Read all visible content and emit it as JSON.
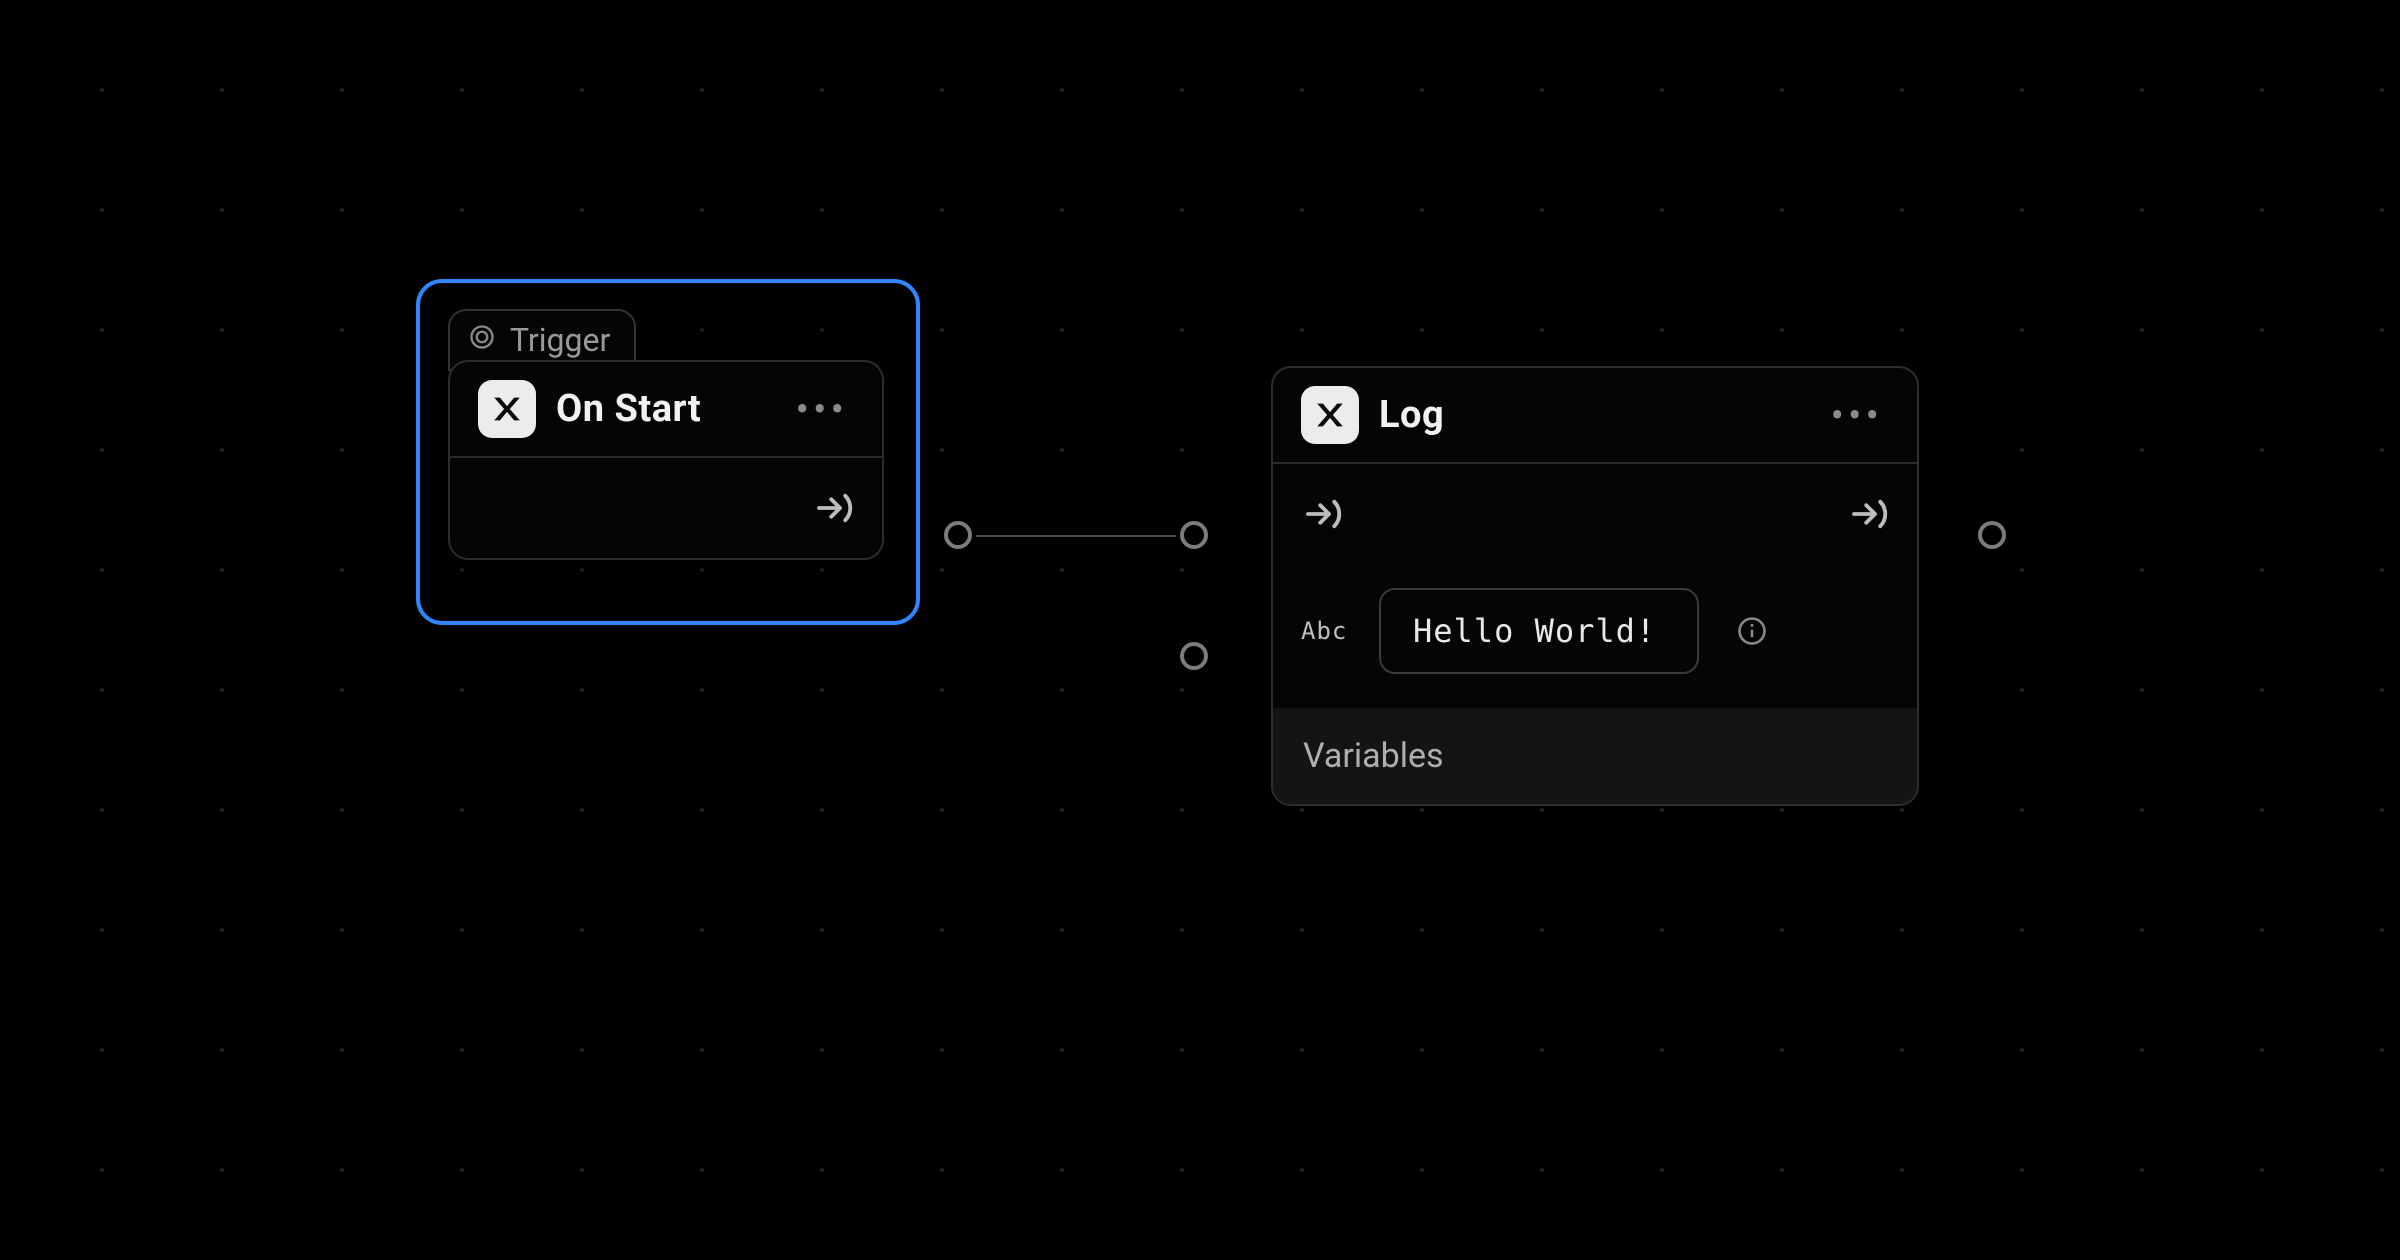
{
  "canvas": {
    "tag_label": "Trigger"
  },
  "nodes": {
    "trigger": {
      "title": "On Start",
      "more": "•••"
    },
    "log": {
      "title": "Log",
      "more": "•••",
      "abc_label": "Abc",
      "text_value": "Hello World!",
      "variables_label": "Variables"
    }
  }
}
